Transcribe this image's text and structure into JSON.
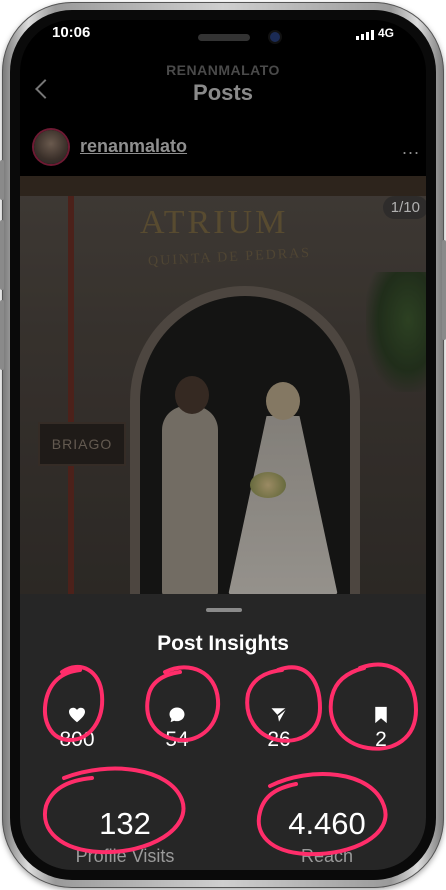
{
  "status_bar": {
    "time": "10:06",
    "signal_label": "4G"
  },
  "nav": {
    "username_small": "RENANMALATO",
    "title": "Posts"
  },
  "post": {
    "username": "renanmalato",
    "more_label": "...",
    "counter": "1/10"
  },
  "photo": {
    "sign_top": "ATRIUM",
    "sign_bottom": "QUINTA DE PEDRAS",
    "board_text": "BRIAGO"
  },
  "insights": {
    "title": "Post Insights",
    "likes": "800",
    "comments": "54",
    "shares": "26",
    "saves": "2",
    "profile_visits": "132",
    "profile_visits_label": "Profile Visits",
    "reach": "4.460",
    "reach_label": "Reach"
  },
  "annotation_color": "#ff2d6a",
  "icons": {
    "back": "chevron-left-icon",
    "like": "heart-icon",
    "comment": "comment-icon",
    "share": "send-icon",
    "save": "bookmark-icon"
  }
}
